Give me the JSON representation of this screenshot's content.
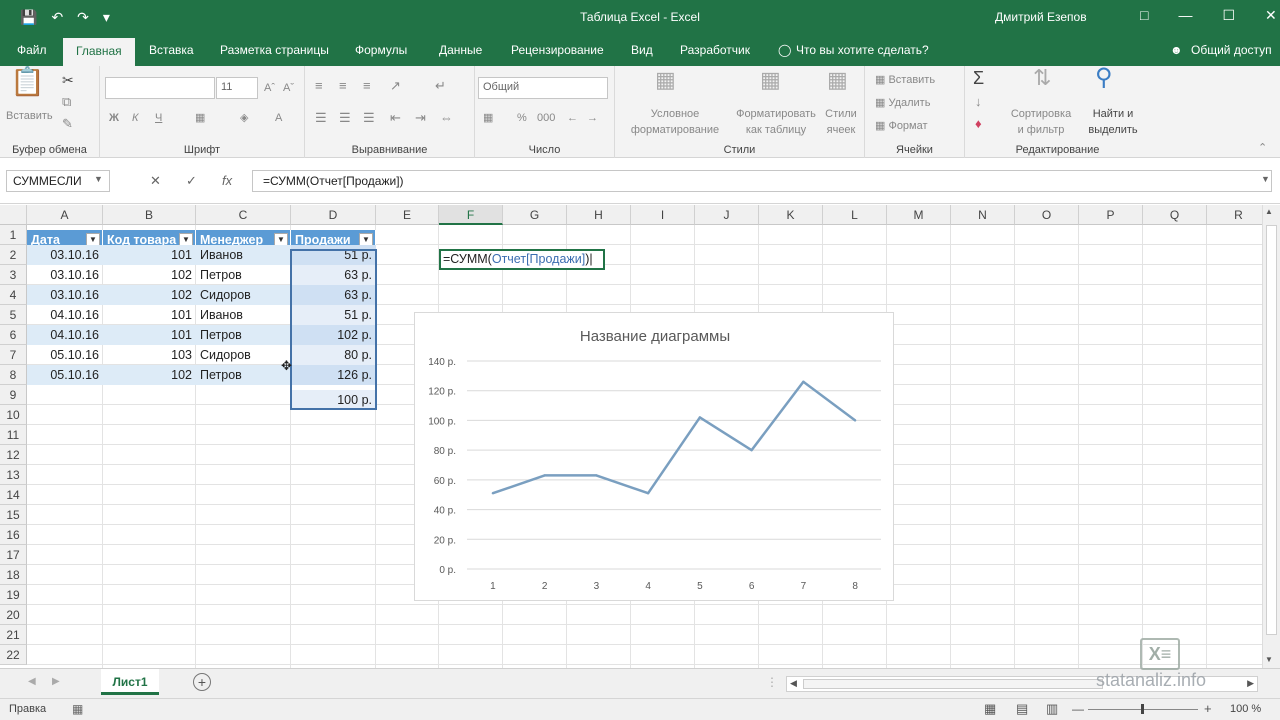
{
  "titlebar": {
    "title": "Таблица Excel  -  Excel",
    "user": "Дмитрий Езепов"
  },
  "tabs": [
    "Файл",
    "Главная",
    "Вставка",
    "Разметка страницы",
    "Формулы",
    "Данные",
    "Рецензирование",
    "Вид",
    "Разработчик",
    "Что вы хотите сделать?"
  ],
  "share": "Общий доступ",
  "ribbon": {
    "clipboard": {
      "label": "Буфер обмена",
      "paste": "Вставить"
    },
    "font": {
      "label": "Шрифт",
      "size": "11",
      "bold": "Ж",
      "italic": "К",
      "underline": "Ч"
    },
    "align": {
      "label": "Выравнивание"
    },
    "number": {
      "label": "Число",
      "format": "Общий",
      "pct": "%",
      "thousands": "000"
    },
    "styles": {
      "label": "Стили",
      "cond1": "Условное",
      "cond2": "форматирование",
      "table1": "Форматировать",
      "table2": "как таблицу",
      "cells1": "Стили",
      "cells2": "ячеек"
    },
    "cells": {
      "label": "Ячейки",
      "insert": "Вставить",
      "delete": "Удалить",
      "format": "Формат"
    },
    "editing": {
      "label": "Редактирование",
      "sort1": "Сортировка",
      "sort2": "и фильтр",
      "find1": "Найти и",
      "find2": "выделить"
    }
  },
  "formula_bar": {
    "namebox": "СУММЕСЛИ",
    "formula": "=СУММ(Отчет[Продажи])",
    "cancel": "✕",
    "enter": "✓",
    "fx": "fx"
  },
  "columns": [
    "A",
    "B",
    "C",
    "D",
    "E",
    "F",
    "G",
    "H",
    "I",
    "J",
    "K",
    "L",
    "M",
    "N",
    "O",
    "P",
    "Q",
    "R"
  ],
  "rows": [
    "1",
    "2",
    "3",
    "4",
    "5",
    "6",
    "7",
    "8",
    "9",
    "10",
    "11",
    "12",
    "13",
    "14",
    "15",
    "16",
    "17",
    "18",
    "19",
    "20",
    "21",
    "22"
  ],
  "table": {
    "headers": [
      "Дата",
      "Код товара",
      "Менеджер",
      "Продажи"
    ],
    "rows": [
      [
        "03.10.16",
        "101",
        "Иванов",
        "51 р."
      ],
      [
        "03.10.16",
        "102",
        "Петров",
        "63 р."
      ],
      [
        "03.10.16",
        "102",
        "Сидоров",
        "63 р."
      ],
      [
        "04.10.16",
        "101",
        "Иванов",
        "51 р."
      ],
      [
        "04.10.16",
        "101",
        "Петров",
        "102 р."
      ],
      [
        "05.10.16",
        "103",
        "Сидоров",
        "80 р."
      ],
      [
        "05.10.16",
        "102",
        "Петров",
        "126 р."
      ]
    ],
    "extra_sales": "100 р."
  },
  "edit_cell": {
    "prefix": "=СУММ(",
    "ref": "Отчет[Продажи]",
    "suffix": ")"
  },
  "chart_data": {
    "type": "line",
    "title": "Название диаграммы",
    "x": [
      "1",
      "2",
      "3",
      "4",
      "5",
      "6",
      "7",
      "8"
    ],
    "series": [
      {
        "values": [
          51,
          63,
          63,
          51,
          102,
          80,
          126,
          100
        ]
      }
    ],
    "ylim": [
      0,
      140
    ],
    "y_ticks": [
      "0 р.",
      "20 р.",
      "40 р.",
      "60 р.",
      "80 р.",
      "100 р.",
      "120 р.",
      "140 р."
    ],
    "grid": true,
    "color": "#7a9fc0"
  },
  "sheet": {
    "tab": "Лист1",
    "add": "+"
  },
  "status": {
    "text": "Правка",
    "zoom": "100 %"
  },
  "watermark": "statanaliz.info"
}
